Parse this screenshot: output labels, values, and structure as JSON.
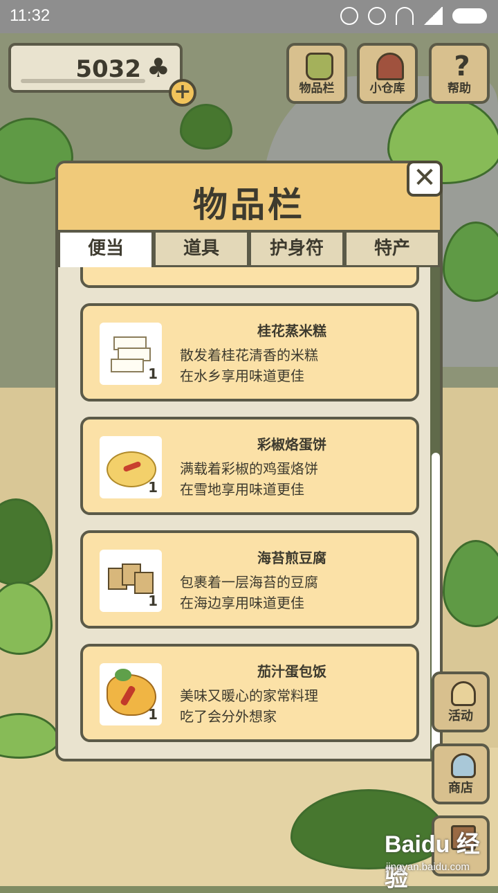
{
  "status_bar": {
    "time": "11:32"
  },
  "currency": {
    "amount": "5032",
    "icon": "clover-icon",
    "add_label": "+"
  },
  "top_buttons": [
    {
      "label": "物品栏",
      "icon": "bag-icon"
    },
    {
      "label": "小仓库",
      "icon": "storage-icon"
    },
    {
      "label": "帮助",
      "icon": "help-icon"
    }
  ],
  "modal": {
    "title": "物品栏",
    "close_label": "✕",
    "tabs": [
      {
        "label": "便当",
        "active": true
      },
      {
        "label": "道具",
        "active": false
      },
      {
        "label": "护身符",
        "active": false
      },
      {
        "label": "特产",
        "active": false
      }
    ],
    "items": [
      {
        "name": "桂花蒸米糕",
        "desc1": "散发着桂花清香的米糕",
        "desc2": "在水乡享用味道更佳",
        "count": "1"
      },
      {
        "name": "彩椒烙蛋饼",
        "desc1": "满载着彩椒的鸡蛋烙饼",
        "desc2": "在雪地享用味道更佳",
        "count": "1"
      },
      {
        "name": "海苔煎豆腐",
        "desc1": "包裹着一层海苔的豆腐",
        "desc2": "在海边享用味道更佳",
        "count": "1"
      },
      {
        "name": "茄汁蛋包饭",
        "desc1": "美味又暖心的家常料理",
        "desc2": "吃了会分外想家",
        "count": "1"
      }
    ]
  },
  "side_buttons": [
    {
      "label": "活动",
      "icon": "leaf-icon"
    },
    {
      "label": "商店",
      "icon": "shop-icon"
    },
    {
      "label": "",
      "icon": "home-icon"
    }
  ],
  "watermark": {
    "brand": "Baidu 经验",
    "url": "jingyan.baidu.com"
  },
  "colors": {
    "header": "#f0ca7a",
    "card": "#fbe1a7",
    "panel": "#e9e3cf",
    "outline": "#5b5a48"
  }
}
